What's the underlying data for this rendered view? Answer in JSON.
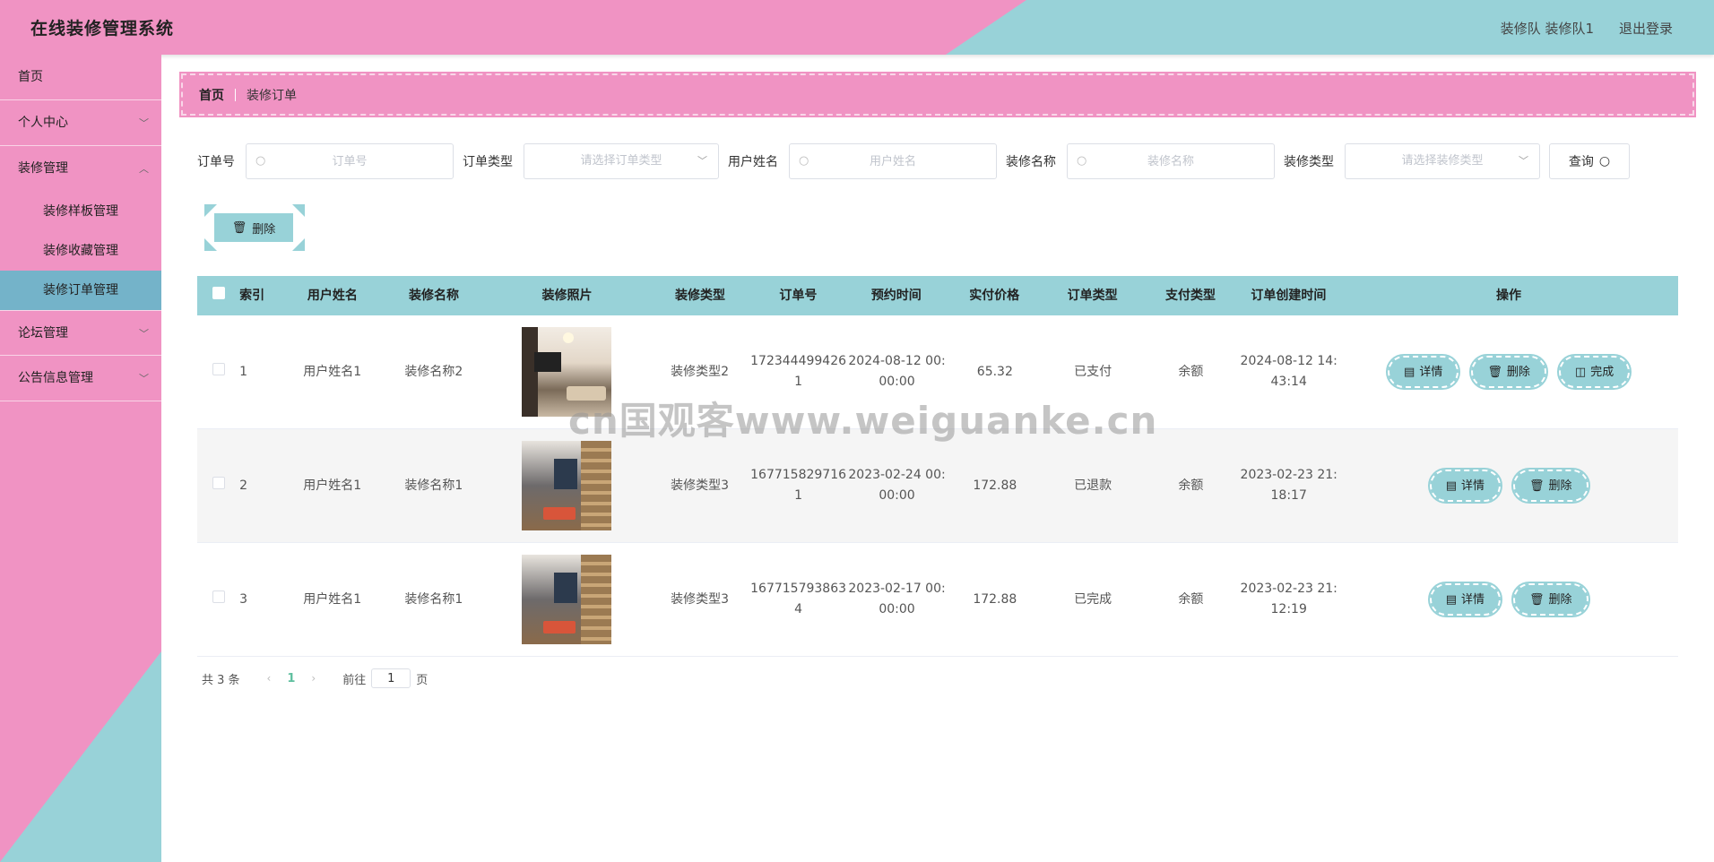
{
  "header": {
    "brand": "在线装修管理系统",
    "user": "装修队 装修队1",
    "logout": "退出登录"
  },
  "sidebar": {
    "items": [
      {
        "label": "首页"
      },
      {
        "label": "个人中心"
      },
      {
        "label": "装修管理"
      },
      {
        "label": "装修样板管理"
      },
      {
        "label": "装修收藏管理"
      },
      {
        "label": "装修订单管理"
      },
      {
        "label": "论坛管理"
      },
      {
        "label": "公告信息管理"
      }
    ]
  },
  "breadcrumb": {
    "home": "首页",
    "current": "装修订单"
  },
  "search": {
    "order_label": "订单号",
    "order_placeholder": "订单号",
    "otype_label": "订单类型",
    "otype_placeholder": "请选择订单类型",
    "user_label": "用户姓名",
    "user_placeholder": "用户姓名",
    "dname_label": "装修名称",
    "dname_placeholder": "装修名称",
    "dtype_label": "装修类型",
    "dtype_placeholder": "请选择装修类型",
    "query": "查询"
  },
  "toolbar": {
    "delete": "删除"
  },
  "table": {
    "headers": [
      "索引",
      "用户姓名",
      "装修名称",
      "装修照片",
      "装修类型",
      "订单号",
      "预约时间",
      "实付价格",
      "订单类型",
      "支付类型",
      "订单创建时间",
      "操作"
    ],
    "rows": [
      {
        "index": "1",
        "user": "用户姓名1",
        "dname": "装修名称2",
        "dtype": "装修类型2",
        "order_a": "172344499426",
        "order_b": "1",
        "time_a": "2024-08-12 00:",
        "time_b": "00:00",
        "price": "65.32",
        "otype": "已支付",
        "ptype": "余额",
        "ctime_a": "2024-08-12 14:",
        "ctime_b": "43:14"
      },
      {
        "index": "2",
        "user": "用户姓名1",
        "dname": "装修名称1",
        "dtype": "装修类型3",
        "order_a": "167715829716",
        "order_b": "1",
        "time_a": "2023-02-24 00:",
        "time_b": "00:00",
        "price": "172.88",
        "otype": "已退款",
        "ptype": "余额",
        "ctime_a": "2023-02-23 21:",
        "ctime_b": "18:17"
      },
      {
        "index": "3",
        "user": "用户姓名1",
        "dname": "装修名称1",
        "dtype": "装修类型3",
        "order_a": "167715793863",
        "order_b": "4",
        "time_a": "2023-02-17 00:",
        "time_b": "00:00",
        "price": "172.88",
        "otype": "已完成",
        "ptype": "余额",
        "ctime_a": "2023-02-23 21:",
        "ctime_b": "12:19"
      }
    ],
    "ops": {
      "detail": "详情",
      "delete": "删除",
      "complete": "完成"
    }
  },
  "pager": {
    "total": "共 3 条",
    "page": "1",
    "goto": "前往",
    "page_value": "1",
    "suffix": "页"
  },
  "watermark": "cn国观客www.weiguanke.cn",
  "colors": {
    "pink": "#f093c3",
    "teal": "#98d2d8",
    "active": "#74b3c9"
  }
}
